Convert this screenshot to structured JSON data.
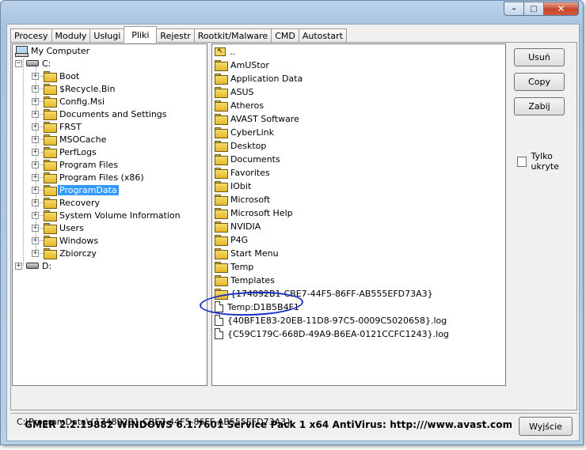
{
  "tabs": [
    "Procesy",
    "Moduły",
    "Usługi",
    "Pliki",
    "Rejestr",
    "Rootkit/Malware",
    "CMD",
    "Autostart"
  ],
  "active_tab": "Pliki",
  "tree": {
    "root": "My Computer",
    "drive_c": "C:",
    "drive_d": "D:",
    "folders": [
      "Boot",
      "$Recycle.Bin",
      "Config.Msi",
      "Documents and Settings",
      "FRST",
      "MSOCache",
      "PerfLogs",
      "Program Files",
      "Program Files (x86)",
      "ProgramData",
      "Recovery",
      "System Volume Information",
      "Users",
      "Windows",
      "Zbiorczy"
    ],
    "selected": "ProgramData"
  },
  "files": {
    "up": "..",
    "folders": [
      "AmUStor",
      "Application Data",
      "ASUS",
      "Atheros",
      "AVAST Software",
      "CyberLink",
      "Desktop",
      "Documents",
      "Favorites",
      "IObit",
      "Microsoft",
      "Microsoft Help",
      "NVIDIA",
      "P4G",
      "Start Menu",
      "Temp",
      "Templates",
      "{174892B1-CBE7-44F5-86FF-AB555EFD73A3}"
    ],
    "files": [
      "Temp:D1B5B4F1",
      "{40BF1E83-20EB-11D8-97C5-0009C5020658}.log",
      "{C59C179C-668D-49A9-B6EA-0121CCFC1243}.log"
    ]
  },
  "buttons": {
    "delete": "Usuń",
    "copy": "Copy",
    "kill": "Zabij",
    "exit": "Wyjście"
  },
  "hidden_only_label": "Tylko ukryte",
  "path": "C:\\ProgramData\\{174892B1-CBE7-44F5-86FF-AB555EFD73A3}",
  "status": "GMER 2.2.19882     WINDOWS 6.1.7601 Service Pack 1 x64     AntiVirus: http:///www.avast.com",
  "window_controls": {
    "minimize": "–",
    "maximize": "□",
    "close": "✕"
  }
}
